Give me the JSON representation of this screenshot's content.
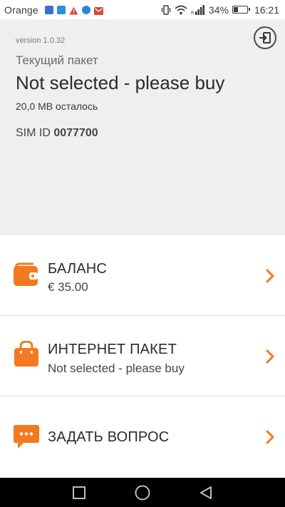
{
  "status_bar": {
    "carrier": "Orange",
    "battery_text": "34%",
    "battery_level": 0.34,
    "time": "16:21",
    "notification_icons": [
      "messenger-icon",
      "app-icon",
      "warning-icon",
      "chat-icon",
      "gmail-icon"
    ],
    "icons": [
      "vibrate-icon",
      "wifi-icon",
      "signal-icon",
      "battery-icon"
    ]
  },
  "header": {
    "version": "version 1.0.32",
    "package_label": "Текущий пакет",
    "package_name": "Not selected - please buy",
    "remaining": "20,0 MB осталось",
    "sim_label": "SIM ID",
    "sim_value": "0077700"
  },
  "menu": {
    "items": [
      {
        "title": "БАЛАНС",
        "subtitle": "€ 35.00",
        "icon": "wallet-icon"
      },
      {
        "title": "ИНТЕРНЕТ ПАКЕТ",
        "subtitle": "Not selected - please buy",
        "icon": "shopping-bag-icon"
      },
      {
        "title": "ЗАДАТЬ ВОПРОС",
        "subtitle": "",
        "icon": "chat-bubble-icon"
      }
    ]
  },
  "colors": {
    "accent": "#f47920",
    "header_bg": "#efefef",
    "text": "#2b2b2b",
    "navbar": "#000000"
  },
  "navbar": {
    "buttons": [
      "recent-apps-icon",
      "home-icon",
      "back-icon"
    ]
  }
}
